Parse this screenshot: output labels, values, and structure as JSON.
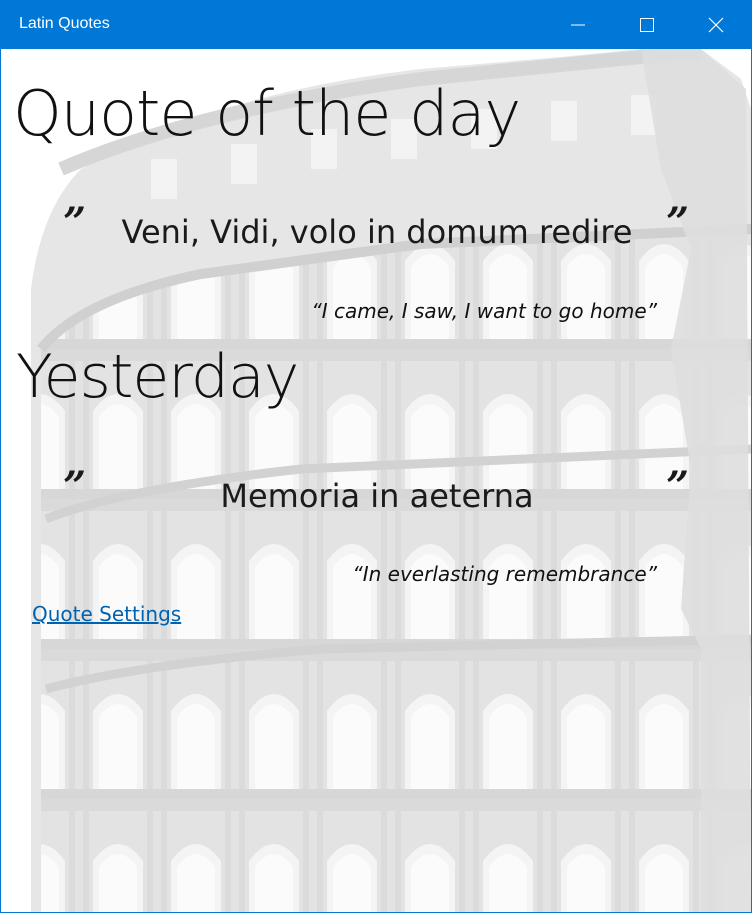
{
  "window": {
    "title": "Latin Quotes",
    "accent_color": "#0078d7",
    "controls": [
      "minimize-icon",
      "maximize-icon",
      "close-icon"
    ]
  },
  "today": {
    "heading": "Quote of the day",
    "open_quote": "”",
    "close_quote": "”",
    "latin": "Veni, Vidi, volo in domum redire",
    "translation": "“I came, I saw, I want to go home”"
  },
  "yesterday": {
    "heading": "Yesterday",
    "open_quote": "”",
    "close_quote": "”",
    "latin": "Memoria in aeterna",
    "translation": "“In everlasting remembrance”"
  },
  "settings": {
    "link_label": "Quote Settings",
    "link_color": "#0063b1"
  },
  "background": {
    "icon": "colosseum-illustration",
    "color": "#e4e4e4"
  }
}
